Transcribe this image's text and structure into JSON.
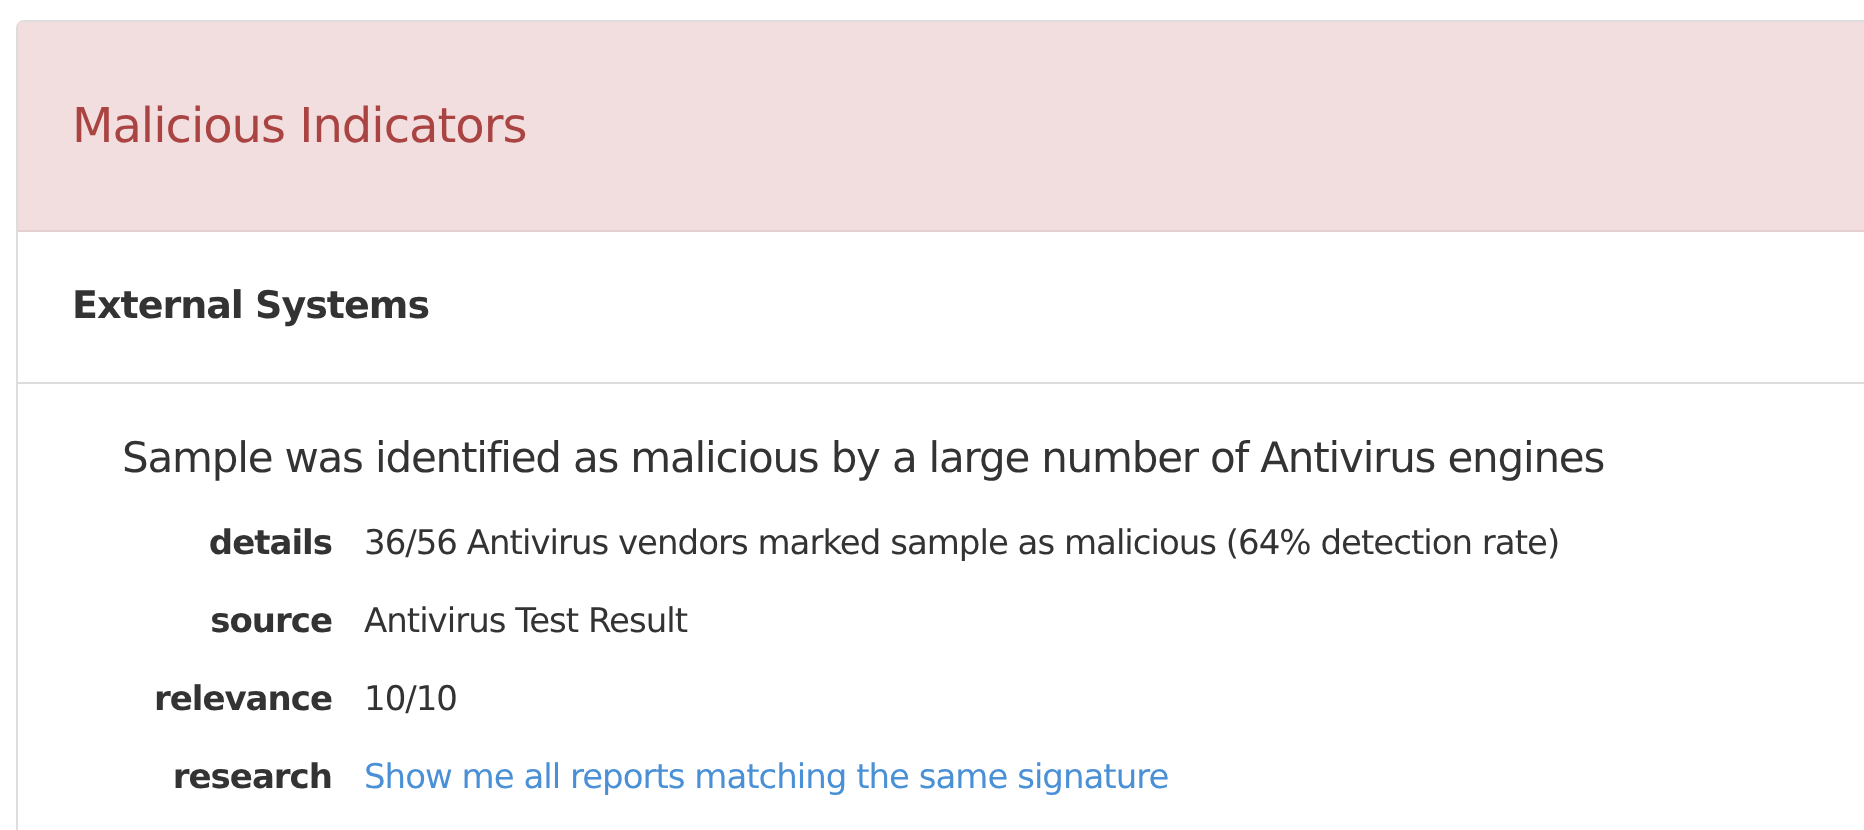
{
  "panel": {
    "title": "Malicious Indicators"
  },
  "section": {
    "title": "External Systems"
  },
  "signature": {
    "headline": "Sample was identified as malicious by a large number of Antivirus engines",
    "fields": [
      {
        "label": "details",
        "value": "36/56 Antivirus vendors marked sample as malicious (64% detection rate)",
        "kind": "text"
      },
      {
        "label": "source",
        "value": "Antivirus Test Result",
        "kind": "text"
      },
      {
        "label": "relevance",
        "value": "10/10",
        "kind": "text"
      },
      {
        "label": "research",
        "value": "Show me all reports matching the same signature",
        "kind": "link"
      }
    ]
  }
}
